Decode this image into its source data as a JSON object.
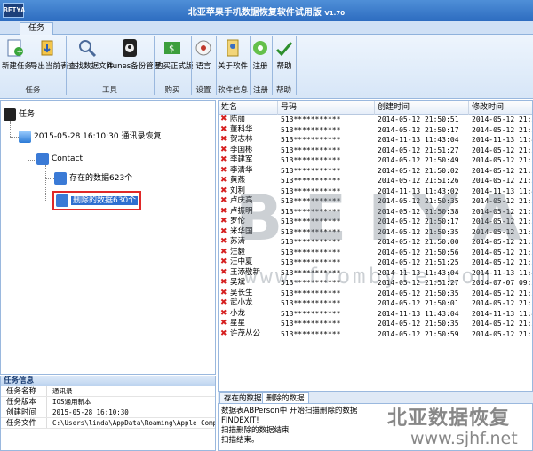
{
  "titlebar": {
    "logo": "BEIYA",
    "title": "北亚苹果手机数据恢复软件试用版",
    "version": "V1.70"
  },
  "tabs": [
    "任务"
  ],
  "ribbon": {
    "buttons": [
      {
        "label": "新建任务",
        "icon": "new-task-icon"
      },
      {
        "label": "导出当前表",
        "icon": "export-icon"
      },
      {
        "label": "查找数据文件",
        "icon": "search-file-icon"
      },
      {
        "label": "itunes备份管理",
        "icon": "itunes-icon"
      },
      {
        "label": "购买正式版",
        "icon": "buy-icon"
      },
      {
        "label": "语言",
        "icon": "language-icon"
      },
      {
        "label": "关于软件",
        "icon": "about-icon"
      },
      {
        "label": "注册",
        "icon": "register-icon"
      },
      {
        "label": "帮助",
        "icon": "help-icon"
      }
    ],
    "groups": [
      "任务",
      "工具",
      "购买",
      "设置",
      "软件信息",
      "注册",
      "帮助"
    ]
  },
  "tree": {
    "root": "任务",
    "session": "2015-05-28 16:10:30 通讯录恢复",
    "contact": "Contact",
    "existing": "存在的数据623个",
    "deleted": "删除的数据630个"
  },
  "info": {
    "header": "任务信息",
    "rows": [
      {
        "k": "任务名称",
        "v": "通讯录"
      },
      {
        "k": "任务版本",
        "v": "IOS通用新本"
      },
      {
        "k": "创建时间",
        "v": "2015-05-28 16:10:30"
      },
      {
        "k": "任务文件",
        "v": "C:\\Users\\linda\\AppData\\Roaming\\Apple Computer\\Mob..."
      }
    ]
  },
  "table": {
    "headers": [
      "姓名",
      "号码",
      "创建时间",
      "修改时间"
    ],
    "rows": [
      {
        "name": "陈丽",
        "num": "513***********",
        "created": "2014-05-12 21:50:51",
        "modified": "2014-05-12 21:50:51"
      },
      {
        "name": "董科华",
        "num": "513***********",
        "created": "2014-05-12 21:50:17",
        "modified": "2014-05-12 21:50:20"
      },
      {
        "name": "贺志林",
        "num": "513***********",
        "created": "2014-11-13 11:43:04",
        "modified": "2014-11-13 11:43:05"
      },
      {
        "name": "李国彬",
        "num": "513***********",
        "created": "2014-05-12 21:51:27",
        "modified": "2014-05-12 21:51:27"
      },
      {
        "name": "李建军",
        "num": "513***********",
        "created": "2014-05-12 21:50:49",
        "modified": "2014-05-12 21:50:53"
      },
      {
        "name": "李清华",
        "num": "513***********",
        "created": "2014-05-12 21:50:02",
        "modified": "2014-05-12 21:50:02"
      },
      {
        "name": "黄燕",
        "num": "513***********",
        "created": "2014-05-12 21:51:26",
        "modified": "2014-05-12 21:51:26"
      },
      {
        "name": "刘利",
        "num": "513***********",
        "created": "2014-11-13 11:43:02",
        "modified": "2014-11-13 11:43:04"
      },
      {
        "name": "卢庆高",
        "num": "513***********",
        "created": "2014-05-12 21:50:35",
        "modified": "2014-05-12 21:50:37"
      },
      {
        "name": "卢振明",
        "num": "513***********",
        "created": "2014-05-12 21:50:38",
        "modified": "2014-05-12 21:50:38"
      },
      {
        "name": "罗伦",
        "num": "513***********",
        "created": "2014-05-12 21:50:17",
        "modified": "2014-05-12 21:50:17"
      },
      {
        "name": "米华国",
        "num": "513***********",
        "created": "2014-05-12 21:50:35",
        "modified": "2014-05-12 21:50:35"
      },
      {
        "name": "苏涛",
        "num": "513***********",
        "created": "2014-05-12 21:50:00",
        "modified": "2014-05-12 21:50:02"
      },
      {
        "name": "汪毅",
        "num": "513***********",
        "created": "2014-05-12 21:50:56",
        "modified": "2014-05-12 21:50:56"
      },
      {
        "name": "汪中夏",
        "num": "513***********",
        "created": "2014-05-12 21:51:25",
        "modified": "2014-05-12 21:51:00"
      },
      {
        "name": "王添敬新",
        "num": "513***********",
        "created": "2014-11-13 11:43:04",
        "modified": "2014-11-13 11:43:04"
      },
      {
        "name": "吴斌",
        "num": "513***********",
        "created": "2014-05-12 21:51:27",
        "modified": "2014-07-07 09:56:31"
      },
      {
        "name": "吴长生",
        "num": "513***********",
        "created": "2014-05-12 21:50:35",
        "modified": "2014-05-12 21:50:37"
      },
      {
        "name": "武小龙",
        "num": "513***********",
        "created": "2014-05-12 21:50:01",
        "modified": "2014-05-12 21:50:03"
      },
      {
        "name": "小龙",
        "num": "513***********",
        "created": "2014-11-13 11:43:04",
        "modified": "2014-11-13 11:43:04"
      },
      {
        "name": "星星",
        "num": "513***********",
        "created": "2014-05-12 21:50:35",
        "modified": "2014-05-12 21:50:35"
      },
      {
        "name": "许茂丛公",
        "num": "513***********",
        "created": "2014-05-12 21:50:59",
        "modified": "2014-05-12 21:51:00"
      }
    ]
  },
  "bottom_tabs": [
    "存在的数据",
    "删除的数据"
  ],
  "log": [
    "数据表ABPerson中 开始扫描删除的数据",
    "FINDEXIT!",
    "扫描删除的数据结束",
    "扫描结束。"
  ],
  "watermark": {
    "letters": "BEIYA",
    "url": "www.frombyte.com"
  },
  "brand": {
    "name": "北亚数据恢复",
    "url": "www.sjhf.net"
  }
}
